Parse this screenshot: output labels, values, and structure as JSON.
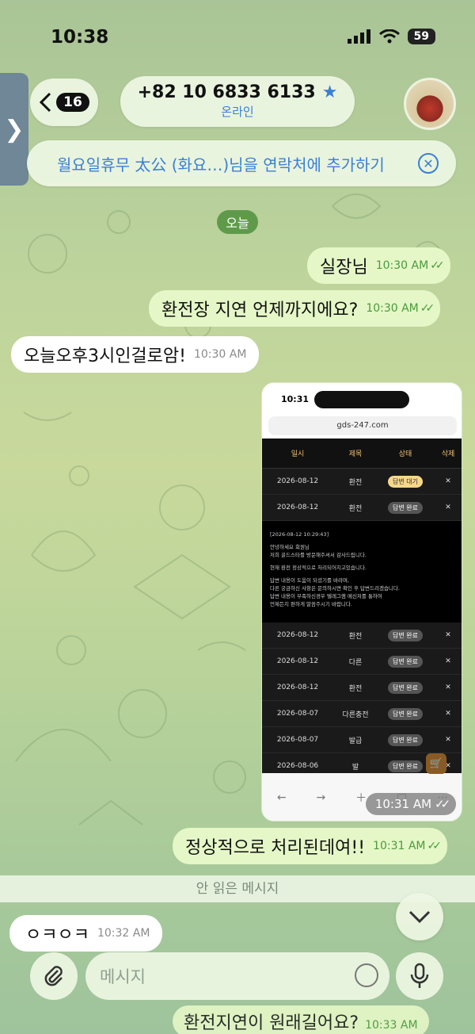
{
  "status": {
    "time": "10:38",
    "battery": "59"
  },
  "header": {
    "back_count": "16",
    "phone": "+82 10 6833 6133",
    "presence": "온라인",
    "add_contact": "월요일휴무 太公 (화요…)님을 연락처에 추가하기"
  },
  "date_label": "오늘",
  "messages": [
    {
      "text": "실장님",
      "time": "10:30 AM",
      "dir": "out"
    },
    {
      "text": "환전장 지연 언제까지에요?",
      "time": "10:30 AM",
      "dir": "out"
    },
    {
      "text": "오늘오후3시인걸로암!",
      "time": "10:30 AM",
      "dir": "in"
    },
    {
      "text": "정상적으로 처리된데여!!",
      "time": "10:31 AM",
      "dir": "out"
    },
    {
      "text": "ㅇㅋㅇㅋ",
      "time": "10:32 AM",
      "dir": "in"
    }
  ],
  "screenshot": {
    "time": "10:31",
    "url": "gds-247.com",
    "headers": [
      "일시",
      "제목",
      "상태",
      "삭제"
    ],
    "rows_top": [
      {
        "date": "2026-08-12",
        "title": "환전",
        "status": "답변 대기"
      },
      {
        "date": "2026-08-12",
        "title": "환전",
        "status": "답변 완료"
      }
    ],
    "message_lines": [
      "[2026-08-12 10:29:43]",
      "안녕하세요 회원님",
      "저희 골드스타를 방문해주셔서 감사드립니다.",
      "현재 환전 정상적으로 처리되어지고있습니다.",
      "답변 내용이 도움이 되셨기를 바라며,",
      "다른 궁금하신 사항은 문의하시면 확인 후 답변드리겠습니다.",
      "답변 내용이 부족하신경우 텔레그램 메신저를 통하여",
      "언제든지 편하게 말씀주시기 바랍니다."
    ],
    "rows_bottom": [
      {
        "date": "2026-08-12",
        "title": "환전",
        "status": "답변 완료"
      },
      {
        "date": "2026-08-12",
        "title": "다른",
        "status": "답변 완료"
      },
      {
        "date": "2026-08-12",
        "title": "환전",
        "status": "답변 완료"
      },
      {
        "date": "2026-08-07",
        "title": "다른충전",
        "status": "답변 완료"
      },
      {
        "date": "2026-08-07",
        "title": "발급",
        "status": "답변 완료"
      },
      {
        "date": "2026-08-06",
        "title": "발",
        "status": "답변 완료"
      }
    ],
    "sent_time": "10:31 AM",
    "cart_count": "0"
  },
  "unread_label": "안 읽은 메시지",
  "input": {
    "placeholder": "메시지"
  },
  "ghost": {
    "text": "환전지연이 원래길어요?",
    "time": "10:33 AM"
  },
  "colors": {
    "accent": "#3a7fd6",
    "out_bubble": "#e5f7c7",
    "in_bubble": "#ffffff",
    "date_chip": "#5f9a4a"
  }
}
